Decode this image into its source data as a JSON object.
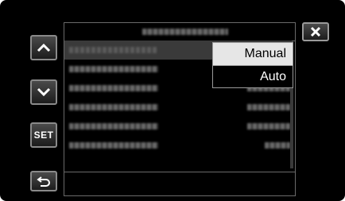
{
  "sidebar": {
    "up_icon": "chevron-up-icon",
    "down_icon": "chevron-down-icon",
    "set_label": "SET",
    "back_icon": "return-arrow-icon"
  },
  "close_icon": "close-icon",
  "dropdown": {
    "options": [
      {
        "label": "Manual",
        "selected": true
      },
      {
        "label": "Auto",
        "selected": false
      }
    ]
  },
  "colors": {
    "screen_bg": "#000000",
    "selected_option_bg": "#e6e6e6",
    "selected_row_bg": "#3a3a3a"
  }
}
